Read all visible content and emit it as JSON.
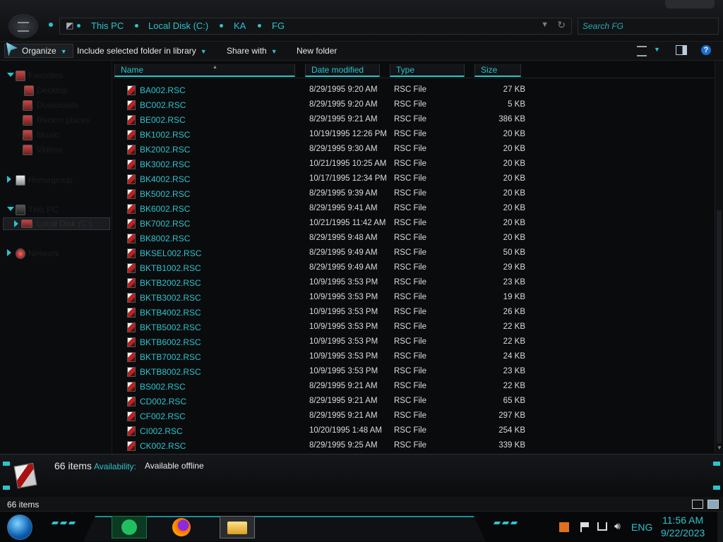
{
  "address": {
    "crumbs": [
      "This PC",
      "Local Disk (C:)",
      "KA",
      "FG"
    ],
    "search_placeholder": "Search FG"
  },
  "toolbar": {
    "organize": "Organize",
    "include": "Include selected folder in library",
    "share": "Share with",
    "new_folder": "New folder"
  },
  "sidebar": {
    "items": [
      {
        "label": "Favorites",
        "icon": "star-icon"
      },
      {
        "label": "Desktop",
        "icon": "desktop-icon"
      },
      {
        "label": "Downloads",
        "icon": "downloads-icon"
      },
      {
        "label": "Recent places",
        "icon": "recent-icon"
      },
      {
        "label": "Music",
        "icon": "music-icon"
      },
      {
        "label": "Videos",
        "icon": "videos-icon"
      },
      {
        "label": "Homegroup",
        "icon": "homegroup-icon"
      },
      {
        "label": "This PC",
        "icon": "computer-icon"
      },
      {
        "label": "Local Disk (C:)",
        "icon": "drive-icon"
      },
      {
        "label": "Network",
        "icon": "network-icon"
      }
    ]
  },
  "columns": {
    "name": "Name",
    "date": "Date modified",
    "type": "Type",
    "size": "Size"
  },
  "files": [
    {
      "name": "BA002.RSC",
      "date": "8/29/1995 9:20 AM",
      "type": "RSC File",
      "size": "27 KB"
    },
    {
      "name": "BC002.RSC",
      "date": "8/29/1995 9:20 AM",
      "type": "RSC File",
      "size": "5 KB"
    },
    {
      "name": "BE002.RSC",
      "date": "8/29/1995 9:21 AM",
      "type": "RSC File",
      "size": "386 KB"
    },
    {
      "name": "BK1002.RSC",
      "date": "10/19/1995 12:26 PM",
      "type": "RSC File",
      "size": "20 KB"
    },
    {
      "name": "BK2002.RSC",
      "date": "8/29/1995 9:30 AM",
      "type": "RSC File",
      "size": "20 KB"
    },
    {
      "name": "BK3002.RSC",
      "date": "10/21/1995 10:25 AM",
      "type": "RSC File",
      "size": "20 KB"
    },
    {
      "name": "BK4002.RSC",
      "date": "10/17/1995 12:34 PM",
      "type": "RSC File",
      "size": "20 KB"
    },
    {
      "name": "BK5002.RSC",
      "date": "8/29/1995 9:39 AM",
      "type": "RSC File",
      "size": "20 KB"
    },
    {
      "name": "BK6002.RSC",
      "date": "8/29/1995 9:41 AM",
      "type": "RSC File",
      "size": "20 KB"
    },
    {
      "name": "BK7002.RSC",
      "date": "10/21/1995 11:42 AM",
      "type": "RSC File",
      "size": "20 KB"
    },
    {
      "name": "BK8002.RSC",
      "date": "8/29/1995 9:48 AM",
      "type": "RSC File",
      "size": "20 KB"
    },
    {
      "name": "BKSEL002.RSC",
      "date": "8/29/1995 9:49 AM",
      "type": "RSC File",
      "size": "50 KB"
    },
    {
      "name": "BKTB1002.RSC",
      "date": "8/29/1995 9:49 AM",
      "type": "RSC File",
      "size": "29 KB"
    },
    {
      "name": "BKTB2002.RSC",
      "date": "10/9/1995 3:53 PM",
      "type": "RSC File",
      "size": "23 KB"
    },
    {
      "name": "BKTB3002.RSC",
      "date": "10/9/1995 3:53 PM",
      "type": "RSC File",
      "size": "19 KB"
    },
    {
      "name": "BKTB4002.RSC",
      "date": "10/9/1995 3:53 PM",
      "type": "RSC File",
      "size": "26 KB"
    },
    {
      "name": "BKTB5002.RSC",
      "date": "10/9/1995 3:53 PM",
      "type": "RSC File",
      "size": "22 KB"
    },
    {
      "name": "BKTB6002.RSC",
      "date": "10/9/1995 3:53 PM",
      "type": "RSC File",
      "size": "22 KB"
    },
    {
      "name": "BKTB7002.RSC",
      "date": "10/9/1995 3:53 PM",
      "type": "RSC File",
      "size": "24 KB"
    },
    {
      "name": "BKTB8002.RSC",
      "date": "10/9/1995 3:53 PM",
      "type": "RSC File",
      "size": "23 KB"
    },
    {
      "name": "BS002.RSC",
      "date": "8/29/1995 9:21 AM",
      "type": "RSC File",
      "size": "22 KB"
    },
    {
      "name": "CD002.RSC",
      "date": "8/29/1995 9:21 AM",
      "type": "RSC File",
      "size": "65 KB"
    },
    {
      "name": "CF002.RSC",
      "date": "8/29/1995 9:21 AM",
      "type": "RSC File",
      "size": "297 KB"
    },
    {
      "name": "CI002.RSC",
      "date": "10/20/1995 1:48 AM",
      "type": "RSC File",
      "size": "254 KB"
    },
    {
      "name": "CK002.RSC",
      "date": "8/29/1995 9:25 AM",
      "type": "RSC File",
      "size": "339 KB"
    }
  ],
  "details": {
    "count": "66 items",
    "availability_label": "Availability:",
    "availability_value": "Available offline"
  },
  "status": {
    "count": "66 items"
  },
  "taskbar": {
    "apps": [
      "notes-app-icon",
      "firefox-icon",
      "file-explorer-icon"
    ],
    "language": "ENG",
    "time": "11:56 AM",
    "date": "9/22/2023"
  },
  "colors": {
    "accent": "#2cc4cc",
    "background": "#0a0b0d"
  }
}
